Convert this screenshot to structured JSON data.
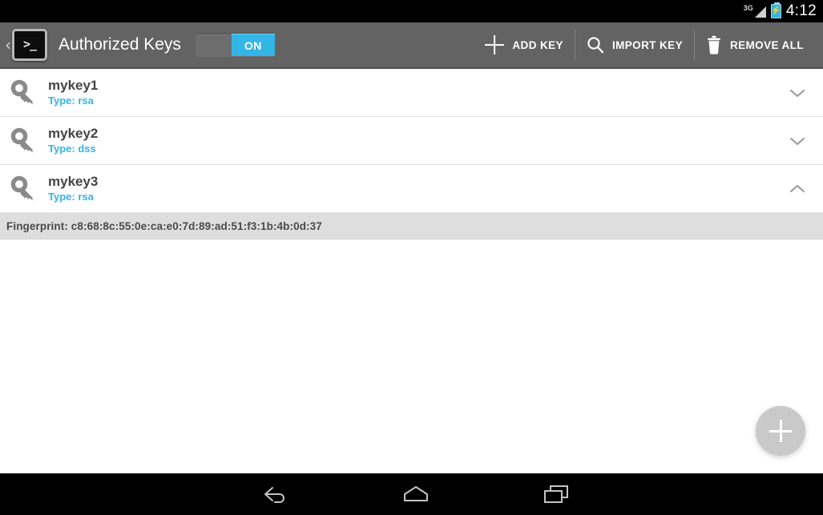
{
  "status_bar": {
    "network_label": "3G",
    "signal_icon": "signal-bars-icon",
    "battery_icon": "battery-charging-icon",
    "time": "4:12"
  },
  "action_bar": {
    "back_caret": "‹",
    "app_icon": "terminal-icon",
    "app_icon_glyph": ">_",
    "title": "Authorized Keys",
    "toggle": {
      "state_label": "ON",
      "enabled": true,
      "on_color": "#33b5e5",
      "track_color": "#6e6e6e"
    },
    "actions": [
      {
        "label": "ADD KEY",
        "icon": "plus-icon"
      },
      {
        "label": "IMPORT KEY",
        "icon": "search-icon"
      },
      {
        "label": "REMOVE ALL",
        "icon": "trash-icon"
      }
    ]
  },
  "key_list": {
    "type_prefix": "Type:",
    "items": [
      {
        "name": "mykey1",
        "type_label": "Type: rsa",
        "key_icon": "key-icon",
        "expanded": false,
        "chevron": "chevron-down-icon"
      },
      {
        "name": "mykey2",
        "type_label": "Type: dss",
        "key_icon": "key-icon",
        "expanded": false,
        "chevron": "chevron-down-icon"
      },
      {
        "name": "mykey3",
        "type_label": "Type: rsa",
        "key_icon": "key-icon",
        "expanded": true,
        "chevron": "chevron-up-icon",
        "fingerprint": "Fingerprint: c8:68:8c:55:0e:ca:e0:7d:89:ad:51:f3:1b:4b:0d:37"
      }
    ]
  },
  "fab": {
    "icon": "plus-icon",
    "background": "#c9c9c9"
  },
  "nav_bar": {
    "back_icon": "back-arrow-icon",
    "home_icon": "home-icon",
    "recents_icon": "recent-apps-icon"
  },
  "colors": {
    "accent": "#33b5e5",
    "action_bar": "#636363",
    "fingerprint_bg": "#dedede",
    "title_text": "#444444"
  }
}
